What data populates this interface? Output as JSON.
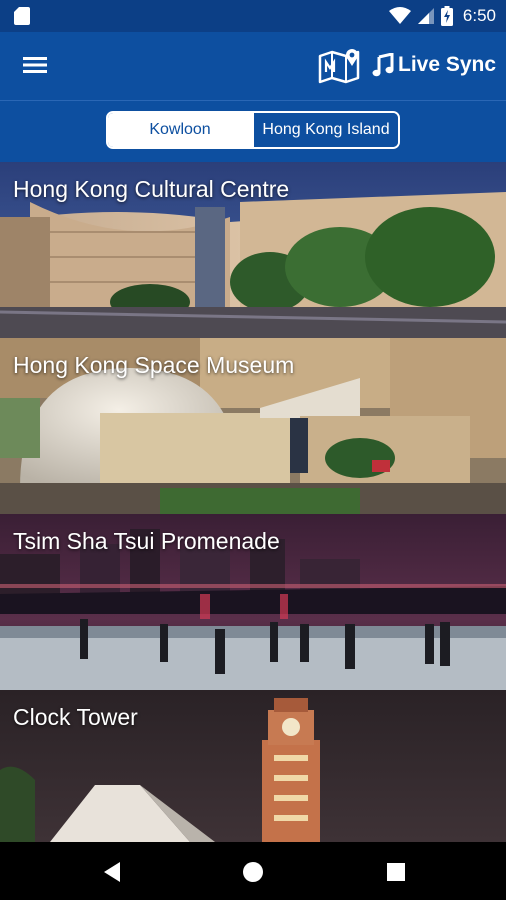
{
  "status_bar": {
    "time": "6:50",
    "icons": [
      "sd-card-icon",
      "wifi-icon",
      "cell-signal-icon",
      "battery-icon"
    ]
  },
  "app_bar": {
    "menu_icon": "hamburger-menu-icon",
    "logo_icon": "map-logo-icon",
    "live_sync_icon": "music-note-icon",
    "live_sync_label": "Live Sync"
  },
  "tabs": [
    {
      "label": "Kowloon",
      "active": true
    },
    {
      "label": "Hong Kong Island",
      "active": false
    }
  ],
  "locations": [
    {
      "title": "Hong Kong Cultural Centre"
    },
    {
      "title": "Hong Kong Space Museum"
    },
    {
      "title": "Tsim Sha Tsui Promenade"
    },
    {
      "title": "Clock Tower"
    }
  ],
  "nav_bar": {
    "icons": [
      "back-icon",
      "home-icon",
      "recents-icon"
    ]
  },
  "colors": {
    "app_bar": "#0d4fa0",
    "status_bar": "#0c3f86",
    "text": "#ffffff"
  }
}
